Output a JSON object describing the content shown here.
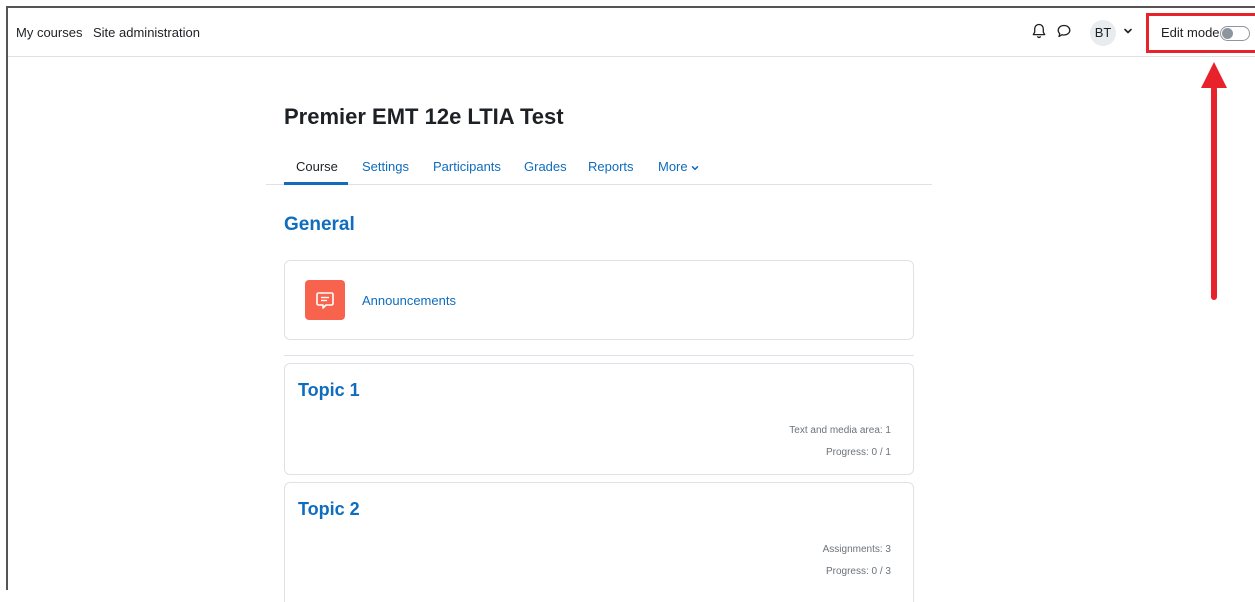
{
  "navbar": {
    "links": [
      "My courses",
      "Site administration"
    ],
    "user_initials": "BT",
    "edit_mode_label": "Edit mode",
    "edit_mode_on": false
  },
  "icons": {
    "notifications": "bell-icon",
    "messages": "chat-bubble-icon",
    "user_menu": "chevron-down-icon",
    "more_tab": "chevron-down-icon",
    "announcements": "forum-icon"
  },
  "course": {
    "title": "Premier EMT 12e LTIA Test",
    "tabs": [
      "Course",
      "Settings",
      "Participants",
      "Grades",
      "Reports",
      "More"
    ],
    "active_tab": "Course"
  },
  "sections": {
    "general": {
      "title": "General",
      "activity": "Announcements"
    },
    "topic1": {
      "title": "Topic 1",
      "meta": "Text and media area: 1",
      "progress": "Progress: 0 / 1"
    },
    "topic2": {
      "title": "Topic 2",
      "meta": "Assignments: 3",
      "progress": "Progress: 0 / 3"
    }
  },
  "colors": {
    "link": "#0f6cbf",
    "highlight": "#e8222a",
    "activity_icon": "#f7634d",
    "text": "#1d2125",
    "muted": "#6a737b",
    "border": "#dee2e6"
  }
}
